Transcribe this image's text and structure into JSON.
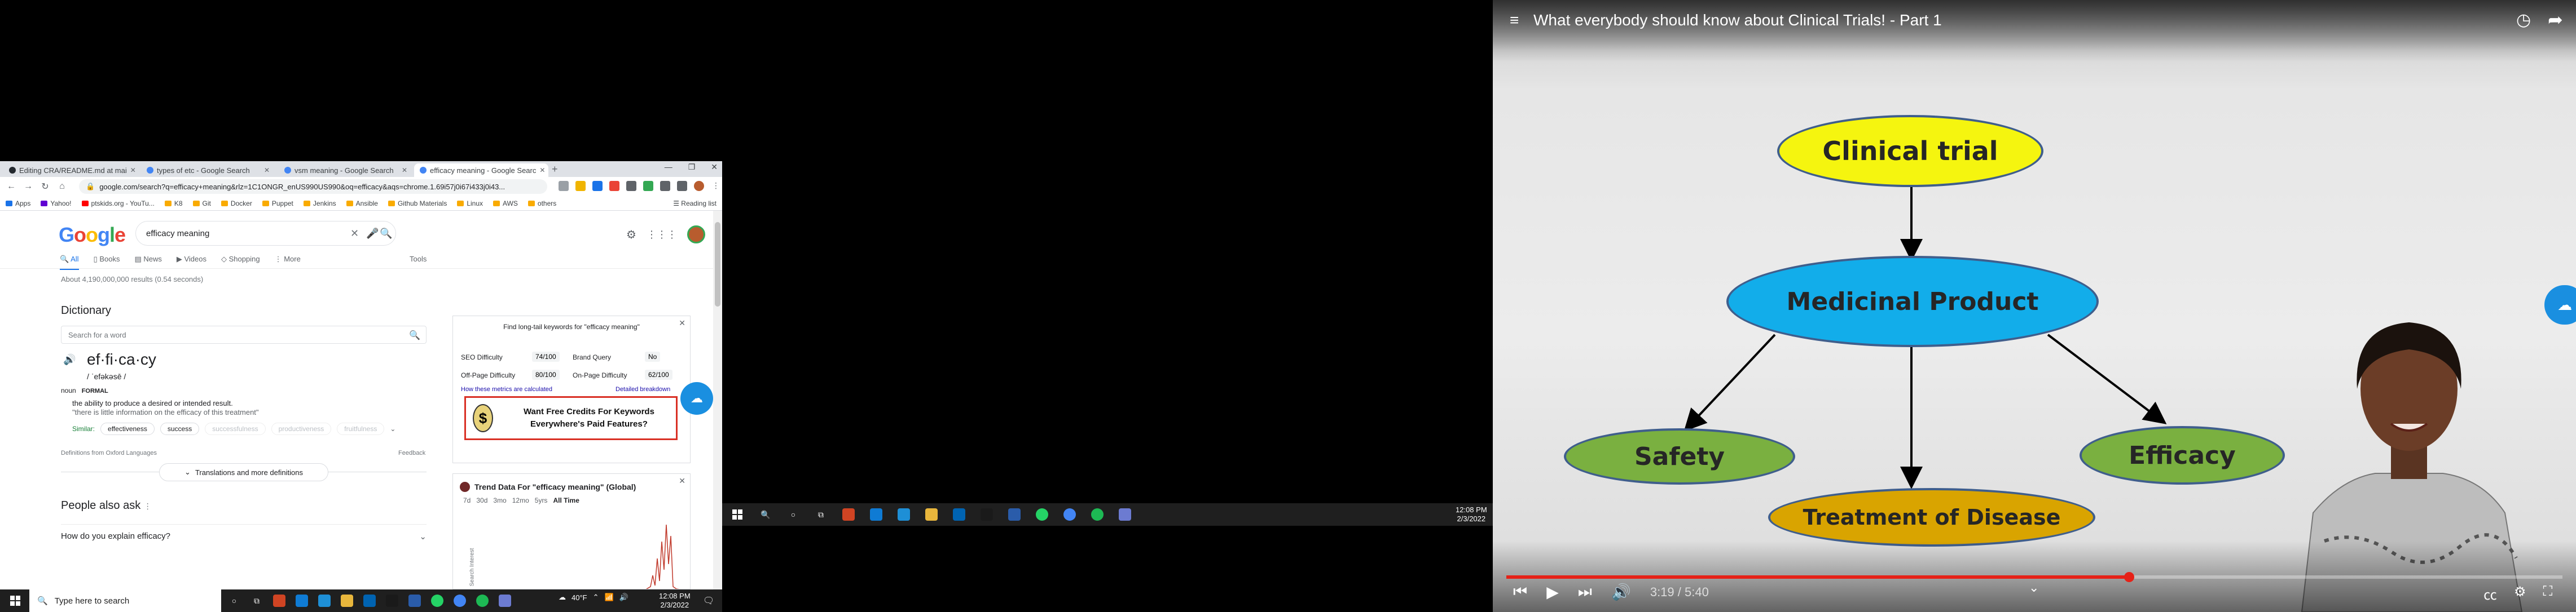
{
  "chrome": {
    "tabs": [
      {
        "label": "Editing CRA/README.md at mai",
        "color": "#24292f"
      },
      {
        "label": "types of etc - Google Search",
        "color": "#4285f4"
      },
      {
        "label": "vsm meaning - Google Search",
        "color": "#4285f4"
      },
      {
        "label": "efficacy meaning - Google Searc",
        "color": "#4285f4"
      }
    ],
    "url": "google.com/search?q=efficacy+meaning&rlz=1C1ONGR_enUS990US990&oq=efficacy&aqs=chrome.1.69i57j0i67i433j0i43...",
    "bookmarks": [
      "Apps",
      "Yahoo!",
      "ptskids.org - YouTu...",
      "K8",
      "Git",
      "Docker",
      "Puppet",
      "Jenkins",
      "Ansible",
      "Github Materials",
      "Linux",
      "AWS",
      "others"
    ],
    "reading_list": "Reading list"
  },
  "google": {
    "logo": "Google",
    "query": "efficacy meaning",
    "tabs": [
      "All",
      "Books",
      "News",
      "Videos",
      "Shopping",
      "More"
    ],
    "tools": "Tools",
    "result_stats": "About 4,190,000,000 results (0.54 seconds)",
    "dictionary": {
      "title": "Dictionary",
      "search_placeholder": "Search for a word",
      "word": "ef·fi·ca·cy",
      "phonetic": "/ ˈefəkəsē /",
      "pos": "noun",
      "formal": "FORMAL",
      "definition": "the ability to produce a desired or intended result.",
      "example": "\"there is little information on the efficacy of this treatment\"",
      "similar_label": "Similar:",
      "similar": [
        "effectiveness",
        "success",
        "successfulness",
        "productiveness",
        "fruitfulness"
      ],
      "from": "Definitions from Oxford Languages",
      "feedback": "Feedback",
      "translations": "Translations and more definitions"
    },
    "people_also_ask": "People also ask",
    "paa_question": "How do you explain efficacy?"
  },
  "seo_widget": {
    "header": "Find long-tail keywords for \"efficacy meaning\"",
    "seo_difficulty_label": "SEO Difficulty",
    "seo_difficulty": "74/100",
    "brand_query_label": "Brand Query",
    "brand_query": "No",
    "offpage_label": "Off-Page Difficulty",
    "offpage": "80/100",
    "onpage_label": "On-Page Difficulty",
    "onpage": "62/100",
    "how_link": "How these metrics are calculated",
    "breakdown_link": "Detailed breakdown",
    "promo": "Want Free Credits For Keywords Everywhere's Paid Features?",
    "promo_icon": "$"
  },
  "trend_widget": {
    "title": "Trend Data For \"efficacy meaning\" (Global)",
    "ranges": [
      "7d",
      "30d",
      "3mo",
      "12mo",
      "5yrs",
      "All Time"
    ],
    "selected_range": "All Time",
    "ylabel": "Search Interest"
  },
  "taskbar": {
    "search_placeholder": "Type here to search",
    "temp": "40°F",
    "time": "12:08 PM",
    "date": "2/3/2022"
  },
  "player": {
    "title": "What everybody should know about Clinical Trials! - Part 1",
    "time_current": "3:19",
    "time_total": "5:40",
    "time_display": "3:19 / 5:40",
    "progress": 0.59,
    "diagram_nodes": {
      "root": "Clinical trial",
      "middle": "Medicinal Product",
      "left": "Safety",
      "right": "Efficacy",
      "bottom": "Treatment of Disease"
    },
    "colors": {
      "root": "#f5f50f",
      "middle": "#12adea",
      "leaf": "#7ab040",
      "bottom": "#d9a400"
    }
  }
}
